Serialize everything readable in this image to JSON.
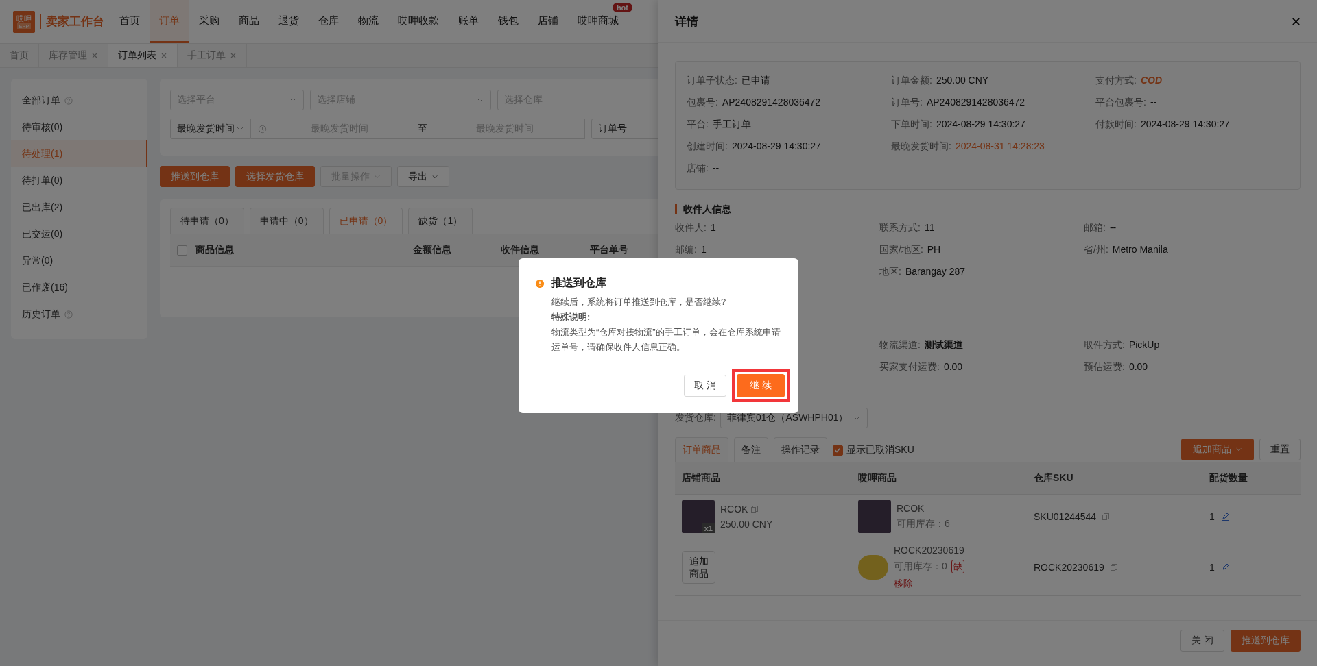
{
  "logo": {
    "mark": "哎呷",
    "mark_sub": "ERP",
    "title": "卖家工作台"
  },
  "nav": [
    {
      "label": "首页",
      "selected": false
    },
    {
      "label": "订单",
      "selected": true
    },
    {
      "label": "采购",
      "selected": false
    },
    {
      "label": "商品",
      "selected": false
    },
    {
      "label": "退货",
      "selected": false
    },
    {
      "label": "仓库",
      "selected": false
    },
    {
      "label": "物流",
      "selected": false
    },
    {
      "label": "哎呷收款",
      "selected": false
    },
    {
      "label": "账单",
      "selected": false
    },
    {
      "label": "钱包",
      "selected": false
    },
    {
      "label": "店铺",
      "selected": false
    },
    {
      "label": "哎呷商城",
      "selected": false,
      "badge": "hot"
    }
  ],
  "page_tabs": [
    {
      "label": "首页",
      "selected": false,
      "closable": false
    },
    {
      "label": "库存管理",
      "selected": false,
      "closable": true
    },
    {
      "label": "订单列表",
      "selected": true,
      "closable": true
    },
    {
      "label": "手工订单",
      "selected": false,
      "closable": true
    }
  ],
  "sidebar": {
    "items": [
      {
        "label": "全部订单",
        "selected": false,
        "help": true
      },
      {
        "label": "待审核(0)",
        "selected": false,
        "help": false
      },
      {
        "label": "待处理(1)",
        "selected": true,
        "help": false
      },
      {
        "label": "待打单(0)",
        "selected": false,
        "help": false
      },
      {
        "label": "已出库(2)",
        "selected": false,
        "help": false
      },
      {
        "label": "已交运(0)",
        "selected": false,
        "help": false
      },
      {
        "label": "异常(0)",
        "selected": false,
        "help": false
      },
      {
        "label": "已作废(16)",
        "selected": false,
        "help": false
      },
      {
        "label": "历史订单",
        "selected": false,
        "help": true
      }
    ]
  },
  "filters": {
    "selects": [
      {
        "placeholder": "选择平台"
      },
      {
        "placeholder": "选择店铺"
      },
      {
        "placeholder": "选择仓库"
      }
    ],
    "time_type": "最晚发货时间",
    "range_start": {
      "placeholder": "最晚发货时间"
    },
    "range_separator": "至",
    "range_end": {
      "placeholder": "最晚发货时间"
    },
    "search_type": "订单号"
  },
  "actions": [
    {
      "label": "推送到仓库",
      "kind": "primary",
      "disabled": false,
      "dropdown": false
    },
    {
      "label": "选择发货仓库",
      "kind": "primary",
      "disabled": false,
      "dropdown": false
    },
    {
      "label": "批量操作",
      "kind": "default",
      "disabled": true,
      "dropdown": true
    },
    {
      "label": "导出",
      "kind": "default",
      "disabled": false,
      "dropdown": true
    }
  ],
  "status_tabs": [
    {
      "label": "待申请（0）",
      "selected": false
    },
    {
      "label": "申请中（0）",
      "selected": false
    },
    {
      "label": "已申请（0）",
      "selected": true
    },
    {
      "label": "缺货（1）",
      "selected": false
    }
  ],
  "order_table": {
    "select_all": false,
    "columns": [
      "商品信息",
      "金额信息",
      "收件信息",
      "平台单号"
    ]
  },
  "drawer": {
    "title": "详情",
    "info_rows": [
      [
        {
          "label": "订单子状态:",
          "value": "已申请",
          "kind": "plain"
        },
        {
          "label": "订单金额:",
          "value": "250.00 CNY",
          "kind": "plain"
        },
        {
          "label": "支付方式:",
          "value": "COD",
          "kind": "code"
        }
      ],
      [
        {
          "label": "包裹号:",
          "value": "AP2408291428036472",
          "kind": "plain"
        },
        {
          "label": "订单号:",
          "value": "AP2408291428036472",
          "kind": "plain"
        },
        {
          "label": "平台包裹号:",
          "value": "--",
          "kind": "plain"
        }
      ],
      [
        {
          "label": "平台:",
          "value": "手工订单",
          "kind": "plain"
        },
        {
          "label": "下单时间:",
          "value": "2024-08-29 14:30:27",
          "kind": "plain"
        },
        {
          "label": "付款时间:",
          "value": "2024-08-29 14:30:27",
          "kind": "plain"
        }
      ],
      [
        {
          "label": "创建时间:",
          "value": "2024-08-29 14:30:27",
          "kind": "plain"
        },
        {
          "label": "最晚发货时间:",
          "value": "2024-08-31 14:28:23",
          "kind": "warning"
        },
        null
      ],
      [
        {
          "label": "店铺:",
          "value": "--",
          "kind": "plain"
        },
        null,
        null
      ]
    ],
    "receiver_title": "收件人信息",
    "receiver_rows": [
      [
        {
          "label": "收件人:",
          "value": "1"
        },
        {
          "label": "联系方式:",
          "value": "11"
        },
        {
          "label": "邮箱:",
          "value": "--"
        }
      ],
      [
        {
          "label": "邮编:",
          "value": "1"
        },
        {
          "label": "国家/地区:",
          "value": "PH"
        },
        {
          "label": "省/州:",
          "value": "Metro Manila"
        }
      ],
      [
        null,
        {
          "label": "地区:",
          "value": "Barangay 287"
        },
        null
      ]
    ],
    "logistics_rows": [
      [
        null,
        {
          "label": "物流渠道:",
          "value": "测试渠道",
          "bold": true
        },
        {
          "label": "取件方式:",
          "value": "PickUp",
          "bold": false
        }
      ],
      [
        null,
        {
          "label": "买家支付运费:",
          "value": "0.00",
          "bold": false
        },
        {
          "label": "预估运费:",
          "value": "0.00",
          "bold": false
        }
      ]
    ],
    "warehouse_label": "发货仓库:",
    "warehouse_value": "菲律宾01仓（ASWHPH01）",
    "detail_tabs": [
      {
        "label": "订单商品",
        "selected": true
      },
      {
        "label": "备注",
        "selected": false
      },
      {
        "label": "操作记录",
        "selected": false
      }
    ],
    "show_cancelled": {
      "label": "显示已取消SKU",
      "checked": true
    },
    "add_button": "追加商品",
    "reset_button": "重置",
    "goods_columns": [
      "店铺商品",
      "哎呷商品",
      "仓库SKU",
      "配货数量"
    ],
    "goods_rows": [
      {
        "store": {
          "kind": "item",
          "name": "RCOK",
          "qty_badge": "x1",
          "price": "250.00 CNY"
        },
        "product": {
          "name": "RCOK",
          "stock": "可用库存：6"
        },
        "sku": "SKU01244544",
        "quantity": "1"
      },
      {
        "store": {
          "kind": "add",
          "label": "追加商品"
        },
        "product": {
          "name": "ROCK20230619",
          "stock": "可用库存：0",
          "shortage": "缺",
          "remove": "移除"
        },
        "sku": "ROCK20230619",
        "quantity": "1"
      }
    ],
    "footer_buttons": [
      {
        "label": "关 闭",
        "kind": "default"
      },
      {
        "label": "推送到仓库",
        "kind": "primary"
      }
    ]
  },
  "dialog": {
    "title": "推送到仓库",
    "message": "继续后，系统将订单推送到仓库，是否继续?",
    "note_title": "特殊说明:",
    "note": "物流类型为“仓库对接物流”的手工订单，会在仓库系统申请运单号，请确保收件人信息正确。",
    "cancel": "取 消",
    "confirm": "继 续",
    "confirm_highlighted": true
  }
}
